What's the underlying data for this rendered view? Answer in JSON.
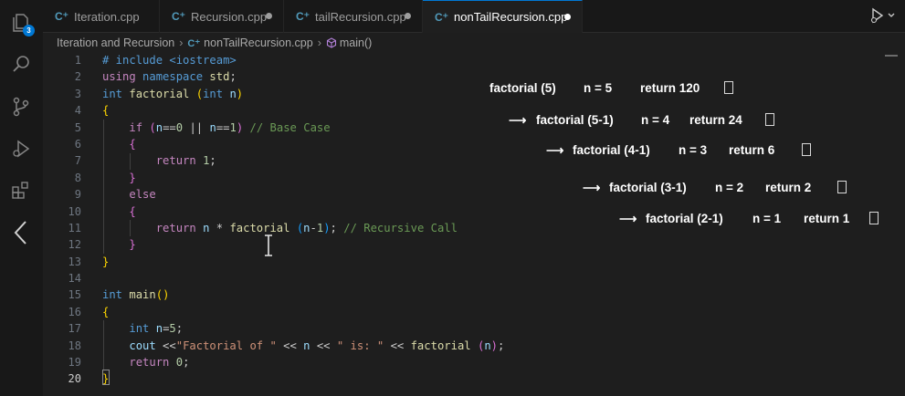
{
  "activity_bar": {
    "explorer_badge": "3",
    "icons": [
      "files-icon",
      "search-icon",
      "source-control-icon",
      "run-debug-icon",
      "extensions-icon",
      "collapse-chevron-icon"
    ]
  },
  "tabs": [
    {
      "label": "Iteration.cpp",
      "icon": "cpp-file-icon",
      "active": false,
      "dirty": false
    },
    {
      "label": "Recursion.cpp",
      "icon": "cpp-file-icon",
      "active": false,
      "dirty": true
    },
    {
      "label": "tailRecursion.cpp",
      "icon": "cpp-file-icon",
      "active": false,
      "dirty": true
    },
    {
      "label": "nonTailRecursion.cpp",
      "icon": "cpp-file-icon",
      "active": true,
      "dirty": true
    }
  ],
  "breadcrumb": {
    "folder": "Iteration and Recursion",
    "file": "nonTailRecursion.cpp",
    "symbol": "main()"
  },
  "editor": {
    "line_numbers": [
      "1",
      "2",
      "3",
      "4",
      "5",
      "6",
      "7",
      "8",
      "9",
      "10",
      "11",
      "12",
      "13",
      "14",
      "15",
      "16",
      "17",
      "18",
      "19",
      "20"
    ],
    "current_line": "20",
    "lines": [
      "# include <iostream>",
      "using namespace std;",
      "int factorial (int n)",
      "{",
      "    if (n==0 || n==1) // Base Case",
      "    {",
      "        return 1;",
      "    }",
      "    else",
      "    {",
      "        return n * factorial (n-1); // Recursive Call",
      "    }",
      "}",
      "",
      "int main()",
      "{",
      "    int n=5;",
      "    cout <<\"Factorial of \" << n << \" is: \" << factorial (n);",
      "    return 0;",
      "}"
    ]
  },
  "trace": [
    {
      "arrow": "",
      "call": "factorial (5)",
      "n": "n = 5",
      "ret": "return 120"
    },
    {
      "arrow": "⟶",
      "call": "factorial (5-1)",
      "n": "n = 4",
      "ret": "return 24"
    },
    {
      "arrow": "⟶",
      "call": "factorial (4-1)",
      "n": "n = 3",
      "ret": "return 6"
    },
    {
      "arrow": "⟶",
      "call": "factorial (3-1)",
      "n": "n = 2",
      "ret": "return 2"
    },
    {
      "arrow": "⟶",
      "call": "factorial (2-1)",
      "n": "n = 1",
      "ret": "return 1"
    }
  ],
  "colors": {
    "editor_bg": "#1e1e1e",
    "accent": "#0078d4",
    "keyword": "#569cd6",
    "function": "#dcdcaa",
    "comment": "#6a9955",
    "string": "#ce9178"
  }
}
